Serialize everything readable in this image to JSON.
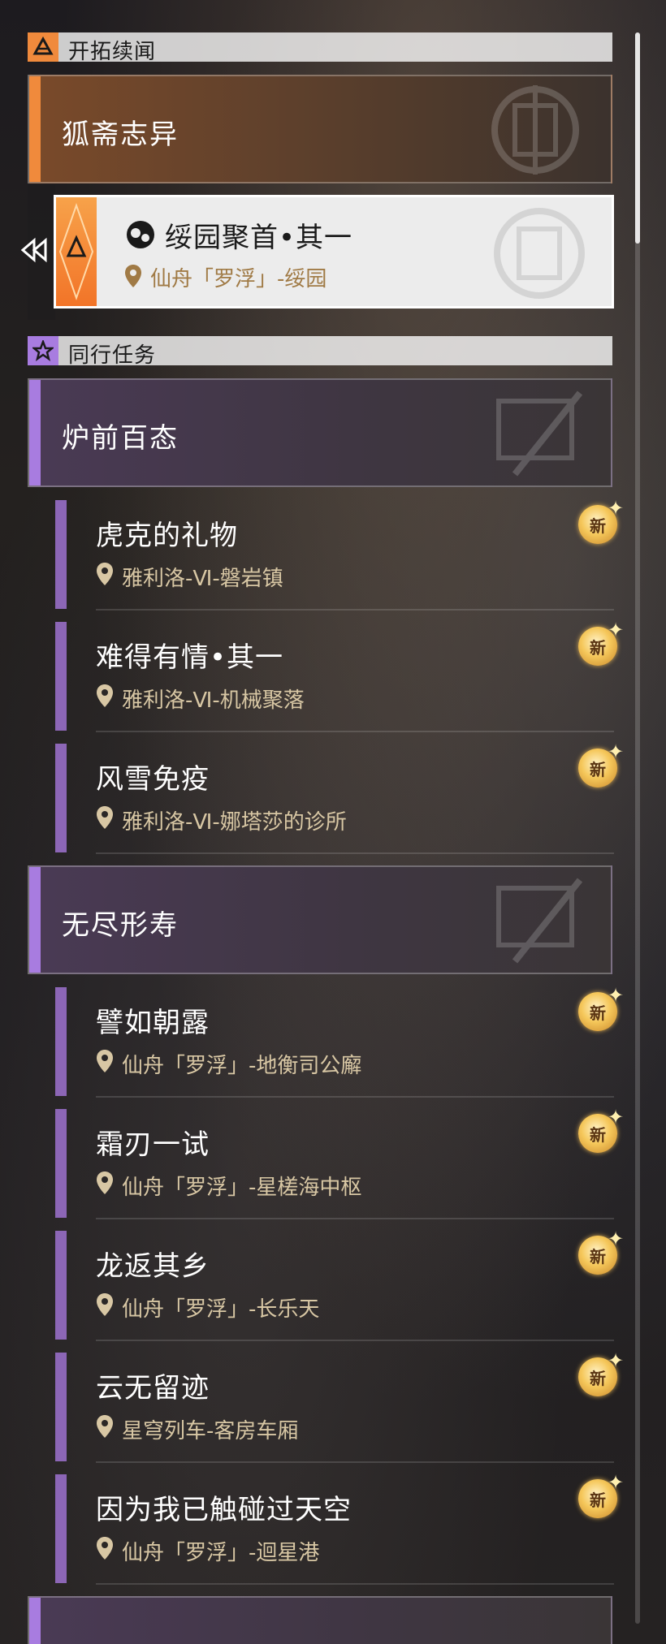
{
  "trailblaze": {
    "section_title": "开拓续闻",
    "group_title": "狐斋志异",
    "active_quest": {
      "title": "绥园聚首•其一",
      "location": "仙舟「罗浮」-绥园"
    }
  },
  "companion": {
    "section_title": "同行任务",
    "groups": [
      {
        "title": "炉前百态",
        "quests": [
          {
            "title": "虎克的礼物",
            "location": "雅利洛-Ⅵ-磐岩镇",
            "badge": "新"
          },
          {
            "title": "难得有情•其一",
            "location": "雅利洛-Ⅵ-机械聚落",
            "badge": "新"
          },
          {
            "title": "风雪免疫",
            "location": "雅利洛-Ⅵ-娜塔莎的诊所",
            "badge": "新"
          }
        ]
      },
      {
        "title": "无尽形寿",
        "quests": [
          {
            "title": "譬如朝露",
            "location": "仙舟「罗浮」-地衡司公廨",
            "badge": "新"
          },
          {
            "title": "霜刃一试",
            "location": "仙舟「罗浮」-星槎海中枢",
            "badge": "新"
          },
          {
            "title": "龙返其乡",
            "location": "仙舟「罗浮」-长乐天",
            "badge": "新"
          },
          {
            "title": "云无留迹",
            "location": "星穹列车-客房车厢",
            "badge": "新"
          },
          {
            "title": "因为我已触碰过天空",
            "location": "仙舟「罗浮」-迴星港",
            "badge": "新"
          }
        ]
      }
    ]
  },
  "colors": {
    "trailblaze_accent": "#f08a3c",
    "companion_accent": "#a87ce0",
    "quest_bar": "#8c66b6",
    "location_text": "#d8c7a4"
  }
}
